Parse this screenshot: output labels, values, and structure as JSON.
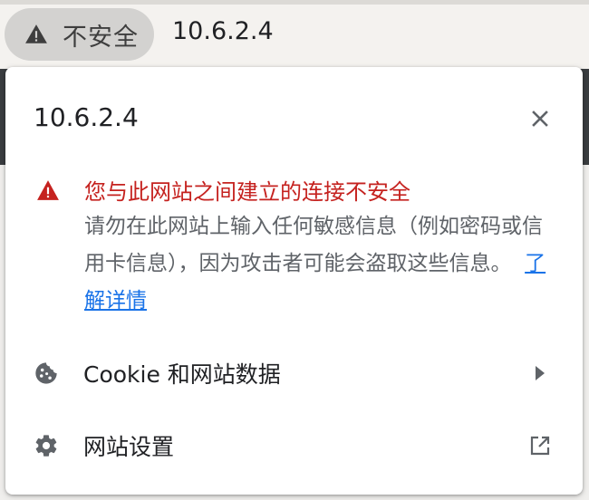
{
  "omnibox": {
    "security_chip_label": "不安全",
    "url": "10.6.2.4"
  },
  "popup": {
    "site_title": "10.6.2.4",
    "security": {
      "title": "您与此网站之间建立的连接不安全",
      "description": "请勿在此网站上输入任何敏感信息（例如密码或信用卡信息），因为攻击者可能会盗取这些信息。",
      "learn_more": "了解详情",
      "color": "#c5221f"
    },
    "rows": [
      {
        "label": "Cookie 和网站数据",
        "icon": "cookie-icon",
        "trailing": "chevron-right-icon"
      },
      {
        "label": "网站设置",
        "icon": "gear-icon",
        "trailing": "open-in-new-icon"
      }
    ]
  },
  "colors": {
    "link": "#1a73e8",
    "text_primary": "#202124",
    "text_secondary": "#5f6368"
  }
}
